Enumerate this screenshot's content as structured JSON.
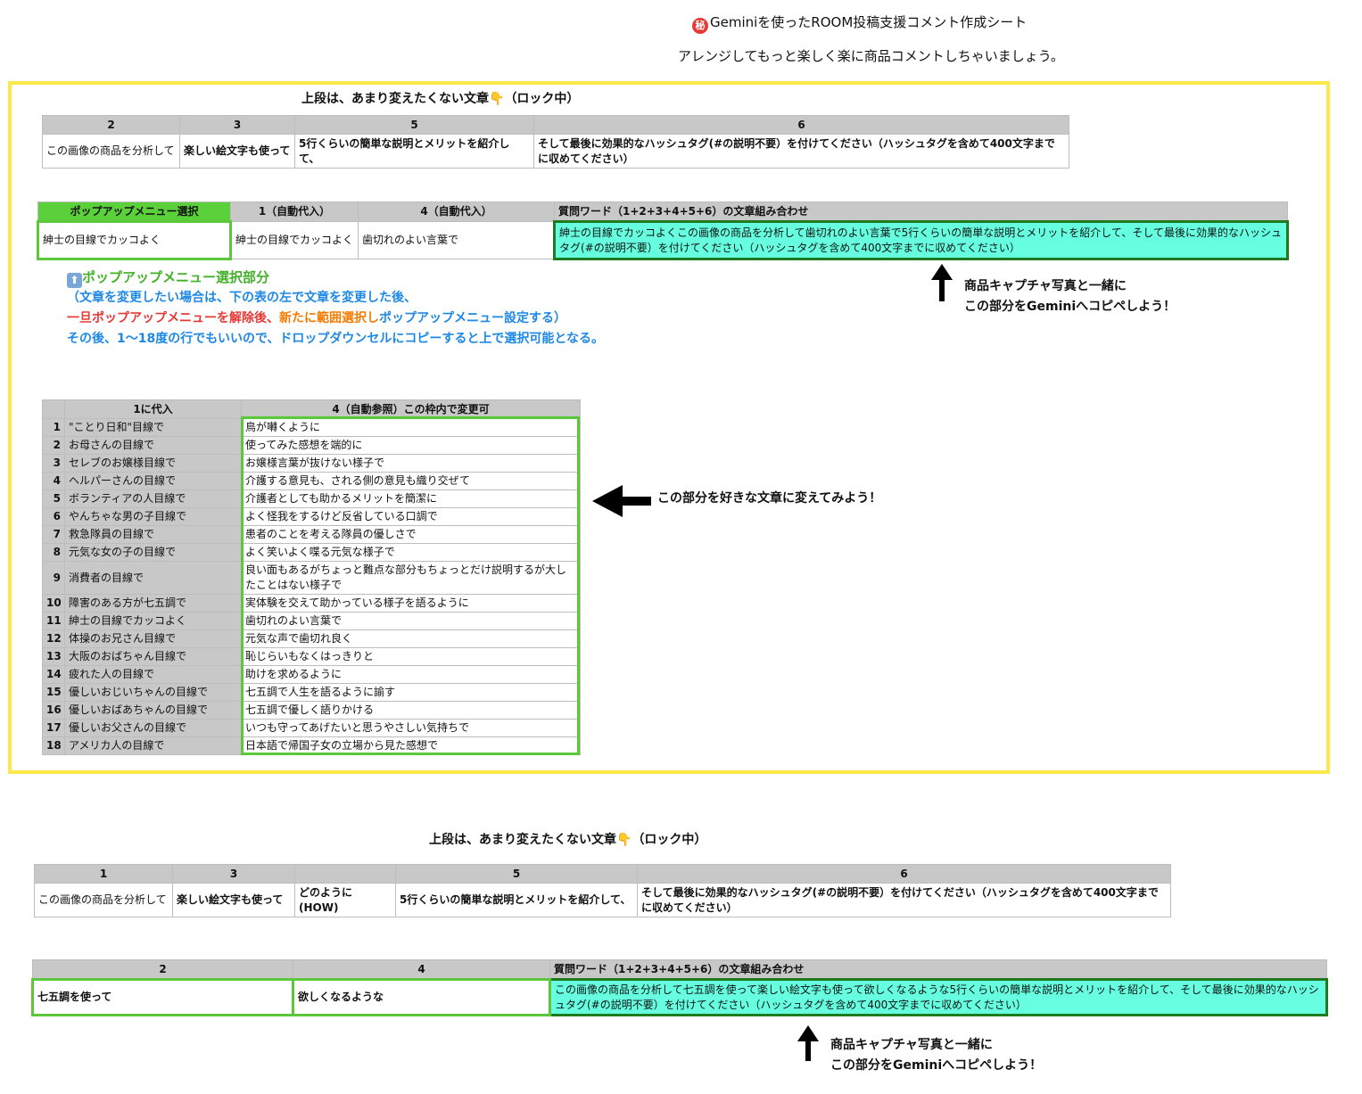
{
  "header": {
    "seal_char": "秘",
    "title": "Geminiを使ったROOM投稿支援コメント作成シート",
    "subtitle": "アレンジしてもっと楽しく楽に商品コメントしちゃいましょう。"
  },
  "section1": {
    "lock_title_a": "上段は、あまり変えたくない文章",
    "lock_icon": "👇",
    "lock_title_b": "（ロック中）",
    "top_table": {
      "headers": [
        "2",
        "3",
        "5",
        "6"
      ],
      "cells": [
        "この画像の商品を分析して",
        "楽しい絵文字も使って",
        "5行くらいの簡単な説明とメリットを紹介して、",
        "そして最後に効果的なハッシュタグ(#の説明不要）を付けてください（ハッシュタグを含めて400文字までに収めてください）"
      ]
    },
    "mid_table": {
      "headers": [
        "ポップアップメニュー選択",
        "1（自動代入）",
        "4（自動代入）",
        "質問ワード（1+2+3+4+5+6）の文章組み合わせ"
      ],
      "cells": [
        "紳士の目線でカッコよく",
        "紳士の目線でカッコよく",
        "歯切れのよい言葉で",
        "紳士の目線でカッコよくこの画像の商品を分析して歯切れのよい言葉で5行くらいの簡単な説明とメリットを紹介して、そして最後に効果的なハッシュタグ(#の説明不要）を付けてください（ハッシュタグを含めて400文字までに収めてください）"
      ]
    },
    "notes": {
      "popup_label_icon": "⬆",
      "popup_label": "ポップアップメニュー選択部分",
      "line2": "（文章を変更したい場合は、下の表の左で文章を変更した後、",
      "line3_red": "一旦ポップアップメニューを解除後、",
      "line3_orange": "新たに範囲選択し",
      "line3_blue": "ポップアップメニュー設定する）",
      "line4": "その後、1〜18度の行でもいいので、ドロップダウンセルにコピーすると上で選択可能となる。"
    },
    "copy_note": {
      "line1": "商品キャプチャ写真と一緒に",
      "line2": "この部分をGeminiへコピペしよう！"
    },
    "list_table": {
      "headers": [
        "1に代入",
        "4（自動参照）この枠内で変更可"
      ],
      "rows": [
        {
          "n": "1",
          "a": "\"ことり日和\"目線で",
          "b": "鳥が囀くように"
        },
        {
          "n": "2",
          "a": "お母さんの目線で",
          "b": "使ってみた感想を端的に"
        },
        {
          "n": "3",
          "a": "セレブのお嬢様目線で",
          "b": "お嬢様言葉が抜けない様子で"
        },
        {
          "n": "4",
          "a": "ヘルパーさんの目線で",
          "b": "介護する意見も、される側の意見も織り交ぜて"
        },
        {
          "n": "5",
          "a": "ボランティアの人目線で",
          "b": "介護者としても助かるメリットを簡潔に"
        },
        {
          "n": "6",
          "a": "やんちゃな男の子目線で",
          "b": "よく怪我をするけど反省している口調で"
        },
        {
          "n": "7",
          "a": "救急隊員の目線で",
          "b": "患者のことを考える隊員の優しさで"
        },
        {
          "n": "8",
          "a": "元気な女の子の目線で",
          "b": "よく笑いよく喋る元気な様子で"
        },
        {
          "n": "9",
          "a": "消費者の目線で",
          "b": "良い面もあるがちょっと難点な部分もちょっとだけ説明するが大したことはない様子で"
        },
        {
          "n": "10",
          "a": "障害のある方が七五調で",
          "b": "実体験を交えて助かっている様子を語るように"
        },
        {
          "n": "11",
          "a": "紳士の目線でカッコよく",
          "b": "歯切れのよい言葉で"
        },
        {
          "n": "12",
          "a": "体操のお兄さん目線で",
          "b": "元気な声で歯切れ良く"
        },
        {
          "n": "13",
          "a": "大阪のおばちゃん目線で",
          "b": "恥じらいもなくはっきりと"
        },
        {
          "n": "14",
          "a": "疲れた人の目線で",
          "b": "助けを求めるように"
        },
        {
          "n": "15",
          "a": "優しいおじいちゃんの目線で",
          "b": "七五調で人生を語るように諭す"
        },
        {
          "n": "16",
          "a": "優しいおばあちゃんの目線で",
          "b": "七五調で優しく語りかける"
        },
        {
          "n": "17",
          "a": "優しいお父さんの目線で",
          "b": "いつも守ってあげたいと思うやさしい気持ちで"
        },
        {
          "n": "18",
          "a": "アメリカ人の目線で",
          "b": "日本語で帰国子女の立場から見た感想で"
        }
      ]
    },
    "change_note": "この部分を好きな文章に変えてみよう！"
  },
  "section2": {
    "lock_title_a": "上段は、あまり変えたくない文章",
    "lock_icon": "👇",
    "lock_title_b": "（ロック中）",
    "top_table": {
      "headers": [
        "1",
        "3",
        "",
        "5",
        "6"
      ],
      "cells": [
        "この画像の商品を分析して",
        "楽しい絵文字も使って",
        "どのように(HOW)",
        "5行くらいの簡単な説明とメリットを紹介して、",
        "そして最後に効果的なハッシュタグ(#の説明不要）を付けてください（ハッシュタグを含めて400文字までに収めてください）"
      ]
    },
    "mid_table": {
      "headers": [
        "2",
        "4",
        "質問ワード（1+2+3+4+5+6）の文章組み合わせ"
      ],
      "cells": [
        "七五調を使って",
        "欲しくなるような",
        "この画像の商品を分析して七五調を使って楽しい絵文字も使って欲しくなるような5行くらいの簡単な説明とメリットを紹介して、そして最後に効果的なハッシュタグ(#の説明不要）を付けてください（ハッシュタグを含めて400文字までに収めてください）"
      ]
    },
    "copy_note": {
      "line1": "商品キャプチャ写真と一緒に",
      "line2": "この部分をGeminiへコピペしよう！"
    }
  },
  "colors": {
    "frame_yellow": "#fbe94a",
    "header_gray": "#c8c8c8",
    "green_border": "#5ac83a",
    "cyan_result": "#66ffe0",
    "dark_green_border": "#1f7a1f"
  }
}
